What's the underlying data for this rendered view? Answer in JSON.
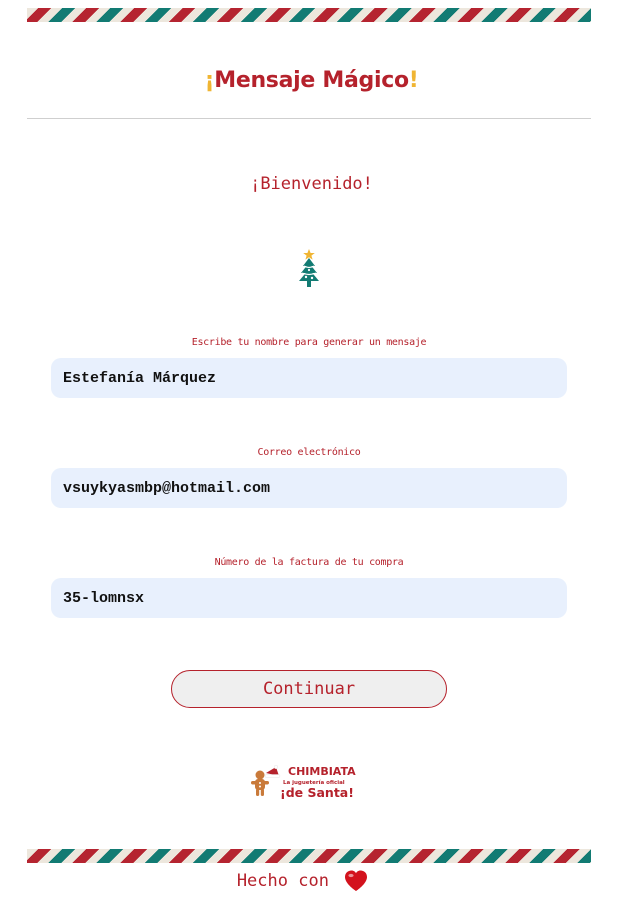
{
  "header": {
    "title_open": "¡",
    "title_main": "Mensaje Mágico",
    "title_close": "!"
  },
  "welcome": "¡Bienvenido!",
  "form": {
    "name_label": "Escribe tu nombre para generar un mensaje",
    "name_value": "Estefanía Márquez",
    "email_label": "Correo electrónico",
    "email_value": "vsuykyasmbp@hotmail.com",
    "invoice_label": "Número de la factura de tu compra",
    "invoice_value": "35-lomnsx",
    "submit_label": "Continuar"
  },
  "logo": {
    "line1": "CHIMBIATA",
    "line2": "La juguetería oficial",
    "line3": "¡de Santa!"
  },
  "footer": {
    "text": "Hecho con"
  },
  "icons": {
    "tree": "christmas-tree-icon",
    "heart": "heart-icon"
  },
  "colors": {
    "brand_red": "#b5222c",
    "accent_yellow": "#f0b533",
    "teal": "#127b73",
    "input_bg": "#e8f0fd"
  }
}
